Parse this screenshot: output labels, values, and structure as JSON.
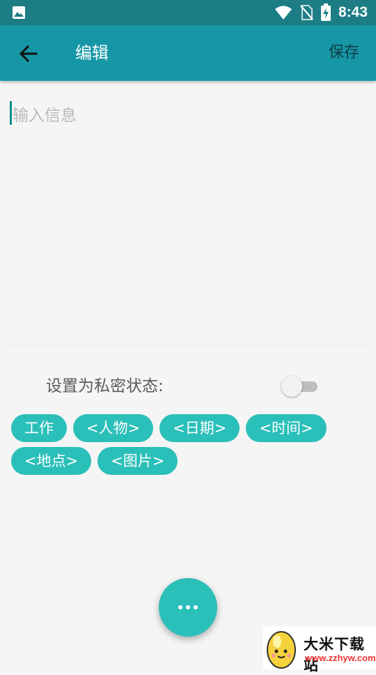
{
  "status_bar": {
    "time": "8:43",
    "icons": [
      "gallery-icon",
      "wifi-icon",
      "no-sim-icon",
      "battery-charging-icon"
    ]
  },
  "app_bar": {
    "back_icon": "arrow-left-icon",
    "title": "编辑",
    "save_label": "保存"
  },
  "editor": {
    "placeholder": "输入信息",
    "value": ""
  },
  "private_setting": {
    "label": "设置为私密状态:",
    "enabled": false
  },
  "tags": [
    "工作",
    "<人物>",
    "<日期>",
    "<时间>",
    "<地点>",
    "<图片>"
  ],
  "fab": {
    "icon": "more-horiz-icon"
  },
  "watermark": {
    "name": "大米下载站",
    "url": "www.zzhyw.com"
  },
  "colors": {
    "status_bar": "#1d7d85",
    "app_bar": "#1697a6",
    "accent": "#2bbfb9",
    "background": "#f5f5f5"
  }
}
